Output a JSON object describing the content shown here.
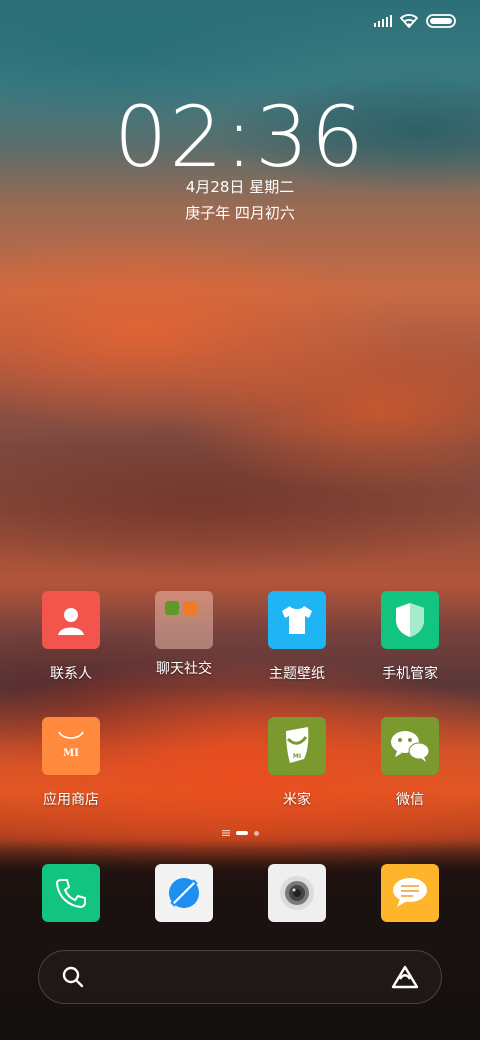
{
  "lock": {
    "time": "02:36",
    "date": "4月28日 星期二",
    "lunar": "庚子年 四月初六"
  },
  "apps_row1": [
    {
      "label": "联系人",
      "icon": "contacts-icon",
      "color": "#f2554b"
    },
    {
      "label": "聊天社交",
      "icon": "folder-icon",
      "color": "#f5c2ad"
    },
    {
      "label": "主题壁纸",
      "icon": "theme-tshirt-icon",
      "color": "#1fb4f4"
    },
    {
      "label": "手机管家",
      "icon": "security-shield-icon",
      "color": "#12c480"
    }
  ],
  "apps_row2": [
    {
      "label": "应用商店",
      "icon": "app-store-bag-icon",
      "color": "#ff8a3d"
    },
    {
      "label": "米家",
      "icon": "mijia-icon",
      "color": "#7a9a2f"
    },
    {
      "label": "微信",
      "icon": "wechat-icon",
      "color": "#7a9a2f"
    }
  ],
  "dock": [
    {
      "icon": "phone-icon",
      "color": "#12c480"
    },
    {
      "icon": "browser-icon",
      "color": "#f2f2f2"
    },
    {
      "icon": "camera-icon",
      "color": "#efefef"
    },
    {
      "icon": "messages-icon",
      "color": "#ffb52b"
    }
  ],
  "store_badge": "MI",
  "mijia_badge": "MI"
}
